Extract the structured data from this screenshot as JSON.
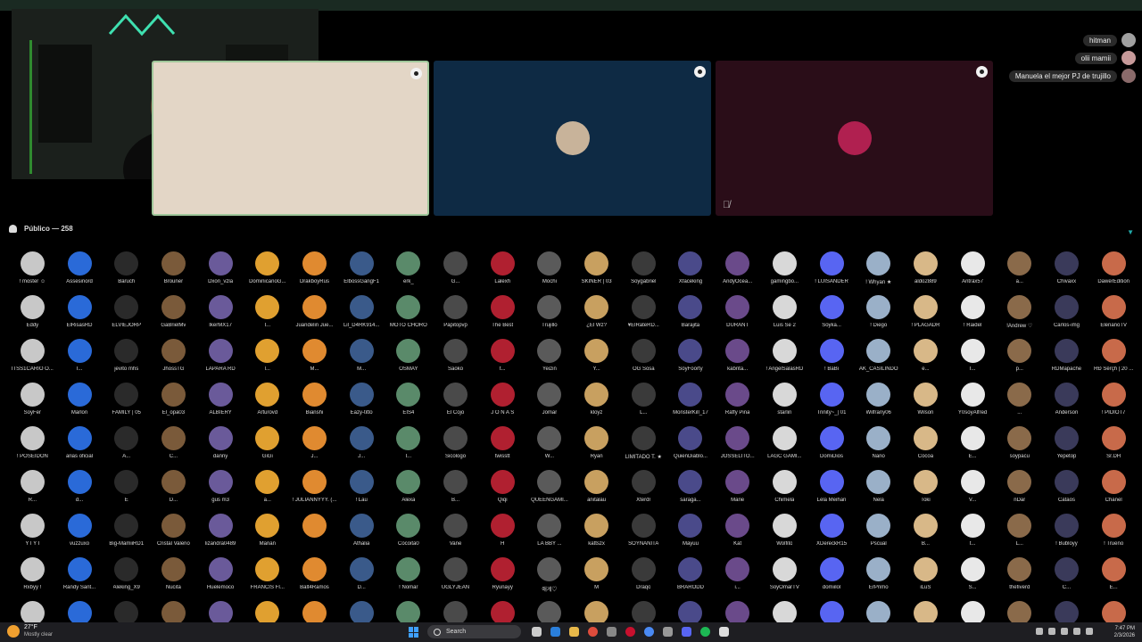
{
  "chat": {
    "messages": [
      "hitman",
      "olii mamii",
      "Manuela el mejor PJ de trujillo"
    ]
  },
  "audience": {
    "header": "Público — 258"
  },
  "members": [
    "! moster ☺",
    "Assesinord",
    "Baruch",
    "Brouner",
    "Dxon_vzla",
    "DominicanoG...",
    "DrakboyRus",
    "ElbossGangF1",
    "erk_",
    "G...",
    "Lalexh",
    "Mochi",
    "SKINER | 03",
    "Soygabriel",
    "Xfaceking",
    "AndyOcea...",
    "gamingbo...",
    "! LUISANDER",
    "! Whyan ★",
    "aldo2889",
    "Antrax57",
    "a...",
    "Chivaxx",
    "DawerEdition",
    "Eddy",
    "ElRisasRD",
    "ELVIEJORP",
    "GaBrielMv",
    "IkerMX17",
    "I...",
    "Juandelin Jue...",
    "Lil_D4RK914...",
    "MOTO CHORO",
    "Papitopvp",
    "The Best",
    "Trujillo",
    "¿El Wz?",
    "¥ElRateRD...",
    "Barajita",
    "DURANT",
    "Luis Se 2",
    "Soyka...",
    "! Diego",
    "! PLAGADR",
    "! Raidel",
    "!Andrew ♡",
    "Carlos-img",
    "ElenanoTV",
    "ITSS1CARIO O...",
    "I...",
    "jevito mhs",
    "JhossTG",
    "LAPARA RD",
    "l...",
    "M...",
    "M...",
    "OSMAY",
    "Saoko",
    "t...",
    "Yeizin",
    "Y...",
    "OG Sosa",
    "SoyFoorty",
    "kabrita...",
    "! AngelSalasRD",
    "! BaBi",
    "AK_CASILINDO",
    "e...",
    "I...",
    "p...",
    "RDMapache",
    "RÐ Šërçh | 20 ...",
    "SoyFer",
    "Marlon",
    "FAMILY | 05",
    "El_opa03",
    "ALBIERY",
    "Arturovd",
    "Bianshi",
    "Eazy-titto",
    "EIS4",
    "El Cojo",
    "J O N A S",
    "Jomar",
    "kloyz",
    "L...",
    "MonsterKill_17",
    "Raffy Pina",
    "starlin",
    "Trinity~_| 01",
    "Wilfrany06",
    "Wilson",
    "Y0soyAlfred",
    "...",
    "Anderson",
    "! PIDIOT7",
    "! POSEIDON",
    "arias oficial",
    "A...",
    "C...",
    "danny",
    "GiGi",
    "J...",
    "J...",
    "I...",
    "Sicologo",
    "twisstt",
    "W...",
    "Ryan",
    "LIMITADO T. ★",
    "QuienDiablo...",
    "JOSSELITO...",
    "LAGC GAMI...",
    "DomiDios",
    "Nano",
    "Cocoa",
    "E...",
    "soypacu",
    "Yepetop",
    "Sr.DH",
    "R...",
    "d...",
    "E",
    "D...",
    "gus m3",
    "a...",
    "! JULIANNYYY. (...",
    "! Lau",
    "Alexa",
    "B...",
    "Qiqi",
    "QUEENGAMI...",
    "anitalau",
    "Xterdr",
    "saraga...",
    "Marie",
    "Chimela",
    "Lela Meihan",
    "Nela",
    "Toki",
    "V...",
    "nDar",
    "Cataos",
    "Chanel",
    "Y I Y I",
    "vuzzuxo",
    "Big-MamiiRD1",
    "Cristal Valerio",
    "lizandra0489",
    "Marian",
    "",
    "Athalia",
    "Cocoita0",
    "Vane",
    "H",
    "LA BBY ...",
    "kattszx",
    "SOYNANITA",
    "Mayuu",
    "Kat",
    "Wolfito",
    "XDereckR15",
    "Pscual",
    "B...",
    "t...",
    "L...",
    "! Bubloyy",
    "! Trueno",
    "Rxbyy !",
    "Randy Sant...",
    "Aleking_X9",
    "Nucita",
    "Huelemoco",
    "FRANCIS FI...",
    "Balt4Ramos",
    "D...",
    "! Nomar",
    "UGLYJEAN",
    "Ryunayy",
    "애게♡",
    "M",
    "Draqo",
    "BRARODD",
    "i...",
    "SoyOmarTV",
    "domiilol",
    "ErPrimo",
    "iLuS",
    "S...",
    "thefiverd",
    "C...",
    "E...",
    "",
    "",
    "",
    "",
    "",
    "",
    "",
    "",
    "",
    "",
    "",
    "",
    "",
    "",
    "",
    "",
    "",
    "",
    "",
    "",
    "",
    "",
    "",
    ""
  ],
  "taskbar": {
    "temperature": "27°F",
    "weather": "Mostly clear",
    "search_placeholder": "Search",
    "time": "7:47 PM",
    "date": "2/3/2026"
  }
}
